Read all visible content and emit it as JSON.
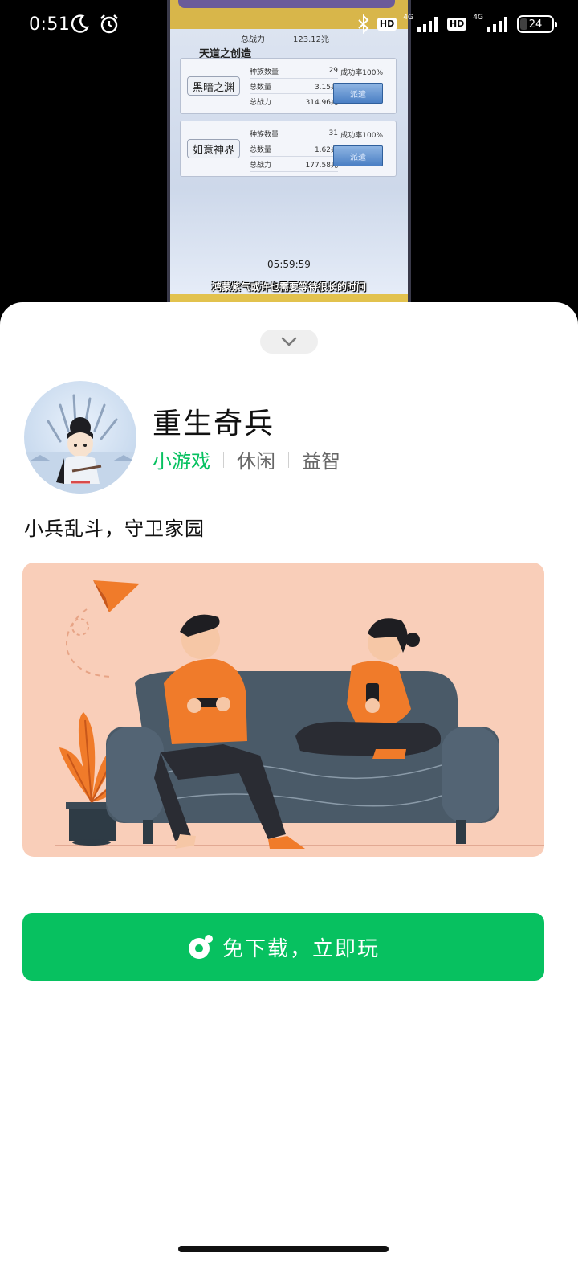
{
  "status_bar": {
    "time": "0:51",
    "network_1": "4G",
    "network_2": "4G",
    "hd_1": "HD",
    "hd_2": "HD",
    "battery": "24"
  },
  "video": {
    "row_top": {
      "label": "总战力",
      "value": "123.12兆"
    },
    "section_title": "天道之创造",
    "realms": [
      {
        "name": "黑暗之渊",
        "count_label": "种族数量",
        "count": "29",
        "amount_label": "总数量",
        "amount": "3.15兆",
        "power_label": "总战力",
        "power": "314.96兆",
        "rate": "成功率100%",
        "button": "派遣"
      },
      {
        "name": "如意神界",
        "count_label": "种族数量",
        "count": "31",
        "amount_label": "总数量",
        "amount": "1.62兆",
        "power_label": "总战力",
        "power": "177.58兆",
        "rate": "成功率100%",
        "button": "派遣"
      }
    ],
    "timer": "05:59:59",
    "subtitle": "鸿蒙紫气或许也需要等待很长的时间"
  },
  "app": {
    "title": "重生奇兵",
    "tags": [
      "小游戏",
      "休闲",
      "益智"
    ],
    "description": "小兵乱斗，守卫家园",
    "play_label": "免下载，立即玩"
  },
  "colors": {
    "accent": "#07c160",
    "banner_bg": "#f9ceb9",
    "sofa": "#4a5a68",
    "shirt": "#f07b2a"
  },
  "icons": [
    "moon-icon",
    "alarm-icon",
    "bluetooth-icon",
    "signal-icon",
    "battery-icon",
    "chevron-down-icon",
    "mini-game-icon"
  ]
}
